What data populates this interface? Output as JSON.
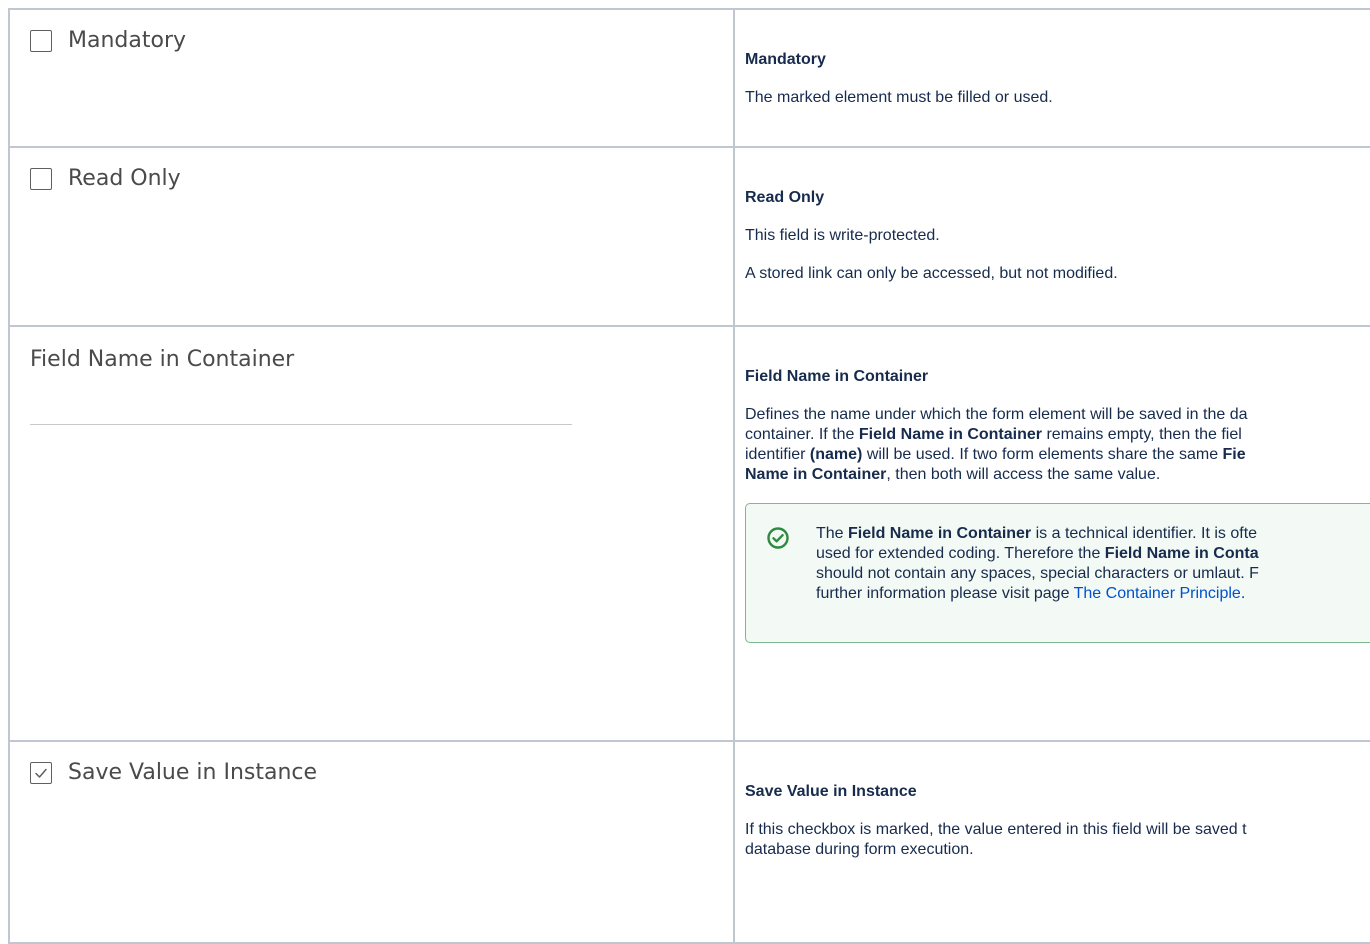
{
  "rows": [
    {
      "screenshot": {
        "type": "checkbox",
        "label": "Mandatory",
        "checked": false
      },
      "title": "Mandatory",
      "paragraphs": [
        "The marked element must be filled or used."
      ]
    },
    {
      "screenshot": {
        "type": "checkbox",
        "label": "Read Only",
        "checked": false
      },
      "title": "Read Only",
      "paragraphs": [
        "This field is write-protected.",
        "A stored link can only be accessed, but not modified."
      ]
    },
    {
      "screenshot": {
        "type": "text-field",
        "label": "Field Name in Container",
        "value": ""
      },
      "title": "Field Name in Container",
      "para": {
        "t1": "Defines the name under which the form element will be saved in the da",
        "t2": "container. If the ",
        "b1": "Field Name in Container",
        "t3": " remains empty, then the fiel",
        "t4": "identifier ",
        "b2": "(name)",
        "t5": " will be used. If two form elements share the same ",
        "b3": "Fie",
        "b4": "Name in Container",
        "t6": ", then both will access the same value."
      },
      "panel": {
        "icon": "check-circle-icon",
        "t1": "The ",
        "b1": "Field Name in Container",
        "t2": " is a technical identifier. It is ofte",
        "t3": "used for extended coding. Therefore the ",
        "b2": "Field Name in Conta",
        "t4": "should not contain any spaces, special characters or umlaut. F",
        "t5": "further information please visit page ",
        "link": "The Container Principle",
        "t6": "."
      }
    },
    {
      "screenshot": {
        "type": "checkbox",
        "label": "Save Value in Instance",
        "checked": true
      },
      "title": "Save Value in Instance",
      "para": {
        "t1": "If this checkbox is marked, the value entered in this field will be saved t",
        "t2": "database during form execution."
      }
    }
  ],
  "colors": {
    "border": "#c1c7d0",
    "panel_border": "#7fb88f",
    "panel_bg": "#f3f9f4",
    "success_icon": "#2e8b3e",
    "link": "#0052cc"
  }
}
